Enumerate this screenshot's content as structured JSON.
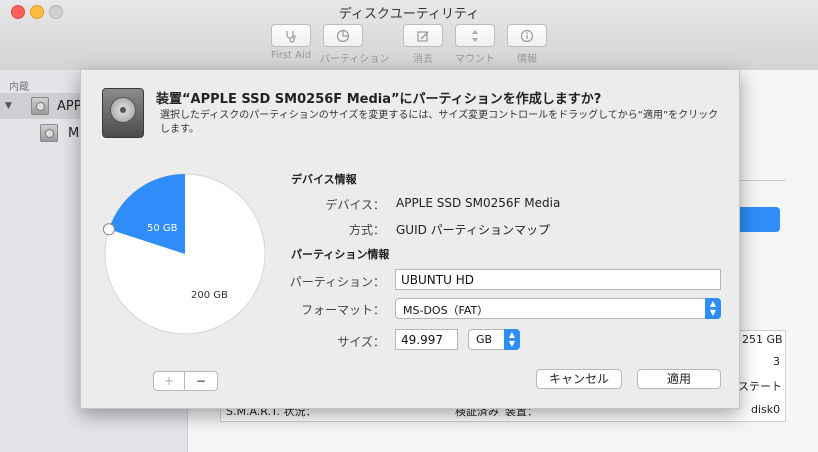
{
  "window": {
    "title": "ディスクユーティリティ",
    "colors": {
      "close": "#fc605b",
      "minimize": "#fdbc40",
      "zoom": "#cfcfcf",
      "accent": "#2e8df9"
    }
  },
  "toolbar": {
    "items": [
      {
        "label": "First Aid",
        "icon": "stethoscope-icon"
      },
      {
        "label": "パーティション",
        "icon": "pie-partition-icon"
      },
      {
        "label": "消去",
        "icon": "erase-icon"
      },
      {
        "label": "マウント",
        "icon": "mount-icon"
      },
      {
        "label": "情報",
        "icon": "info-icon"
      }
    ]
  },
  "sidebar": {
    "section": "内蔵",
    "disk_label": "APP",
    "volume_label": "M"
  },
  "background": {
    "col_251": "251 GB",
    "col_3": "3",
    "col_state": "ステート",
    "smart_label": "S.M.A.R.T. 状況：",
    "smart_value": "検証済み",
    "device_label": "装置：",
    "device_value": "disk0"
  },
  "sheet": {
    "title": "装置“APPLE SSD SM0256F Media”にパーティションを作成しますか?",
    "description": "選択したディスクのパーティションのサイズを変更するには、サイズ変更コントロールをドラッグしてから“適用”をクリックします。",
    "device_info": {
      "heading": "デバイス情報",
      "device_label": "デバイス：",
      "device_value": "APPLE SSD SM0256F Media",
      "scheme_label": "方式：",
      "scheme_value": "GUID パーティションマップ"
    },
    "partition_info": {
      "heading": "パーティション情報",
      "name_label": "パーティション：",
      "name_value": "UBUNTU HD",
      "format_label": "フォーマット：",
      "format_value": "MS-DOS（FAT）",
      "size_label": "サイズ：",
      "size_value": "49.997",
      "unit_value": "GB"
    },
    "pie": {
      "slices": [
        {
          "label": "50 GB",
          "value": 50,
          "color": "#2e8df9"
        },
        {
          "label": "200 GB",
          "value": 200,
          "color": "#ffffff"
        }
      ]
    },
    "buttons": {
      "add": "+",
      "remove": "−",
      "cancel": "キャンセル",
      "apply": "適用"
    }
  }
}
